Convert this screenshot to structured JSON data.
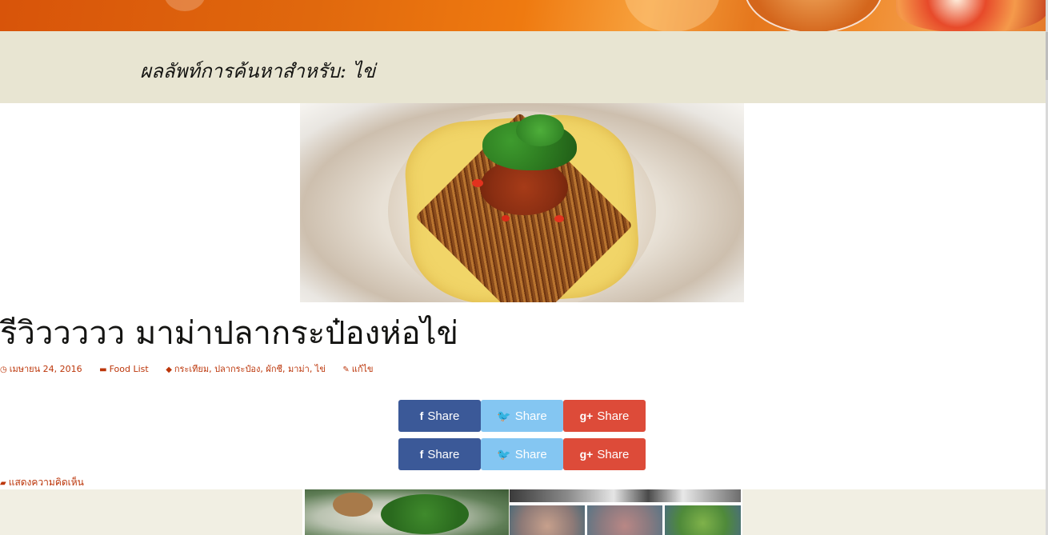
{
  "search": {
    "results_title": "ผลลัพท์การค้นหาสำหรับ: ไข่"
  },
  "post": {
    "title": "รีวิววววว มาม่าปลากระป๋องห่อไข่",
    "date": "เมษายน 24, 2016",
    "category": "Food List",
    "tags": "กระเทียม, ปลากระป๋อง, ผักชี, มาม่า, ไข่",
    "edit": "แก้ไข",
    "comment_link": "แสดงความคิดเห็น"
  },
  "share": {
    "rows": [
      {
        "facebook": "Share",
        "twitter": "Share",
        "googleplus": "Share"
      },
      {
        "facebook": "Share",
        "twitter": "Share",
        "googleplus": "Share"
      }
    ]
  },
  "icons": {
    "facebook": "f",
    "twitter": "🐦",
    "googleplus": "g+",
    "clock": "clock-icon",
    "folder": "folder-icon",
    "tag": "tag-icon",
    "pencil": "pencil-icon",
    "comment": "comment-icon"
  },
  "colors": {
    "accent": "#bc360a",
    "header_bg": "#e8e5d2",
    "facebook": "#3b5998",
    "twitter": "#84c6f2",
    "googleplus": "#dd4b39"
  }
}
